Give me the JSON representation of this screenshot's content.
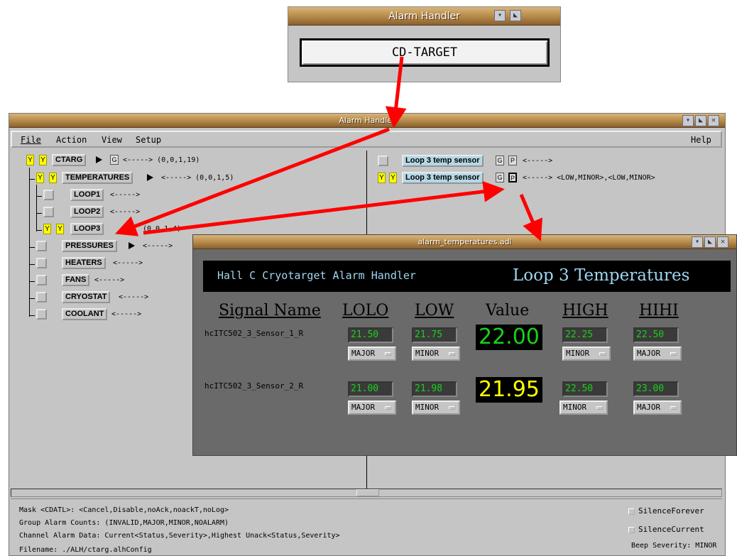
{
  "top_window": {
    "title": "Alarm Handler",
    "button_label": "CD-TARGET"
  },
  "main_window": {
    "title": "Alarm Handler",
    "menu": {
      "file": "File",
      "action": "Action",
      "view": "View",
      "setup": "Setup",
      "help": "Help"
    },
    "tree": {
      "root": {
        "y1": "Y",
        "y2": "Y",
        "label": "CTARG",
        "g": "G",
        "info": "<-----> (0,0,1,19)"
      },
      "items": [
        {
          "label": "TEMPERATURES",
          "info": "<-----> (0,0,1,5)"
        },
        {
          "label": "LOOP1",
          "info": "<----->"
        },
        {
          "label": "LOOP2",
          "info": "<----->"
        },
        {
          "label": "LOOP3",
          "info": "(0,0,1,4)"
        },
        {
          "label": "PRESSURES",
          "info": "<----->"
        },
        {
          "label": "HEATERS",
          "info": "<----->"
        },
        {
          "label": "FANS",
          "info": "<----->"
        },
        {
          "label": "CRYOSTAT",
          "info": "<----->"
        },
        {
          "label": "COOLANT",
          "info": "<----->"
        }
      ],
      "y": "Y"
    },
    "channels": [
      {
        "label": "Loop 3 temp sensor",
        "g": "G",
        "p": "P",
        "info": "<----->"
      },
      {
        "label": "Loop 3 temp sensor",
        "g": "G",
        "p": "P",
        "info": "<-----> <LOW,MINOR>,<LOW,MINOR>"
      }
    ],
    "status": {
      "mask": "Mask <CDATL>: <Cancel,Disable,noAck,noackT,noLog>",
      "group": "Group Alarm Counts: (INVALID,MAJOR,MINOR,NOALARM)",
      "channel": "Channel Alarm Data: Current<Status,Severity>,Highest Unack<Status,Severity>",
      "filename": "Filename: ./ALH/ctarg.alhConfig",
      "silence_forever": "SilenceForever",
      "silence_current": "SilenceCurrent",
      "beep": "Beep Severity: MINOR"
    }
  },
  "adl_window": {
    "title": "alarm_temperatures.adl",
    "banner_left": "Hall C Cryotarget Alarm Handler",
    "banner_right": "Loop 3 Temperatures",
    "columns": {
      "signal": "Signal Name",
      "lolo": "LOLO",
      "low": "LOW",
      "value": "Value",
      "high": "HIGH",
      "hihi": "HIHI"
    },
    "rows": [
      {
        "name": "hcITC502_3_Sensor_1_R",
        "lolo": "21.50",
        "lolo_sev": "MAJOR",
        "low": "21.75",
        "low_sev": "MINOR",
        "value": "22.00",
        "value_color": "#19d219",
        "high": "22.25",
        "high_sev": "MINOR",
        "hihi": "22.50",
        "hihi_sev": "MAJOR"
      },
      {
        "name": "hcITC502_3_Sensor_2_R",
        "lolo": "21.00",
        "lolo_sev": "MAJOR",
        "low": "21.98",
        "low_sev": "MINOR",
        "value": "21.95",
        "value_color": "#ffff00",
        "high": "22.50",
        "high_sev": "MINOR",
        "hihi": "23.00",
        "hihi_sev": "MAJOR"
      }
    ]
  },
  "colors": {
    "annotation_arrow": "#ff0000",
    "alarm_yellow": "#ffff00"
  }
}
